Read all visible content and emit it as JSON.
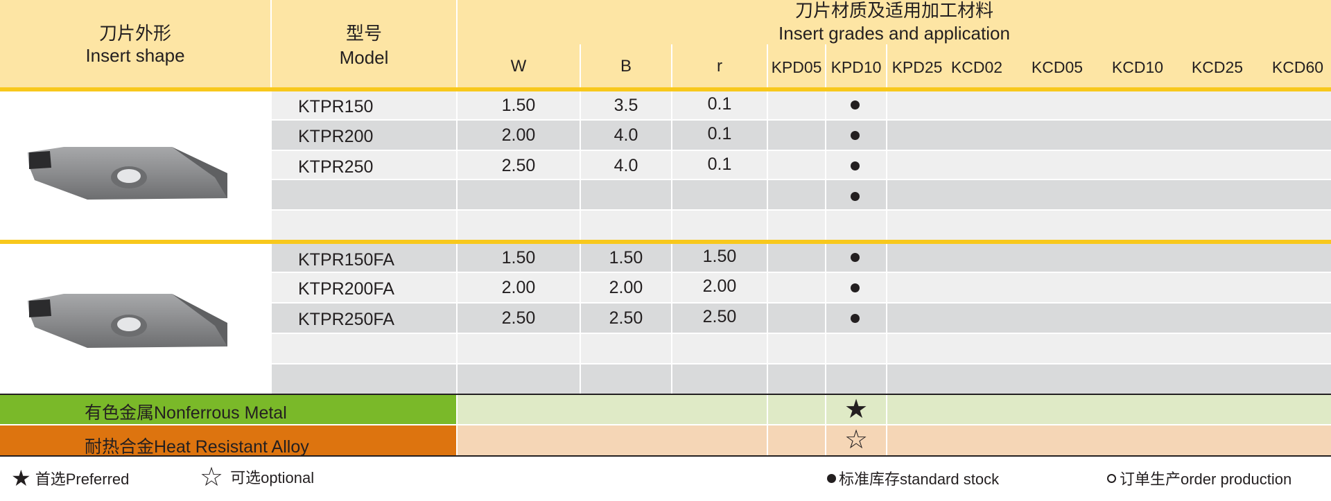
{
  "header": {
    "shape_cn": "刀片外形",
    "shape_en": "Insert shape",
    "model_cn": "型号",
    "model_en": "Model",
    "grades_cn": "刀片材质及适用加工材料",
    "grades_en": "Insert grades and application",
    "dims": [
      "W",
      "B",
      "r"
    ],
    "grades": [
      "KPD05",
      "KPD10",
      "KPD25",
      "KCD02",
      "KCD05",
      "KCD10",
      "KCD25",
      "KCD60"
    ]
  },
  "groups": [
    {
      "rows": [
        {
          "model": "KTPR150",
          "w": "1.50",
          "b": "3.5",
          "r": "0.1",
          "kpd10": true
        },
        {
          "model": "KTPR200",
          "w": "2.00",
          "b": "4.0",
          "r": "0.1",
          "kpd10": true
        },
        {
          "model": "KTPR250",
          "w": "2.50",
          "b": "4.0",
          "r": "0.1",
          "kpd10": true
        },
        {
          "model": "",
          "w": "",
          "b": "",
          "r": "",
          "kpd10": true
        },
        {
          "model": "",
          "w": "",
          "b": "",
          "r": "",
          "kpd10": false
        }
      ]
    },
    {
      "rows": [
        {
          "model": "KTPR150FA",
          "w": "1.50",
          "b": "1.50",
          "r": "1.50",
          "kpd10": true
        },
        {
          "model": "KTPR200FA",
          "w": "2.00",
          "b": "2.00",
          "r": "2.00",
          "kpd10": true
        },
        {
          "model": "KTPR250FA",
          "w": "2.50",
          "b": "2.50",
          "r": "2.50",
          "kpd10": true
        },
        {
          "model": "",
          "w": "",
          "b": "",
          "r": "",
          "kpd10": false
        },
        {
          "model": "",
          "w": "",
          "b": "",
          "r": "",
          "kpd10": false
        }
      ]
    }
  ],
  "materials": [
    {
      "label": "有色金属Nonferrous Metal",
      "color": "#7ab929",
      "tint": "#dfeac6",
      "mark": "★"
    },
    {
      "label": "耐热合金Heat Resistant Alloy",
      "color": "#dd740f",
      "tint": "#f5d6b6",
      "mark": "☆"
    }
  ],
  "legend": {
    "preferred_icon": "★",
    "preferred": "首选Preferred",
    "optional_icon": "☆",
    "optional": "可选optional",
    "stock": "标准库存standard stock",
    "order": "订单生产order production"
  },
  "colors": {
    "header_bg": "#fde5a4",
    "yellow_rule": "#f8c81c",
    "row_light": "#efefef",
    "row_dark": "#d9dadb"
  }
}
